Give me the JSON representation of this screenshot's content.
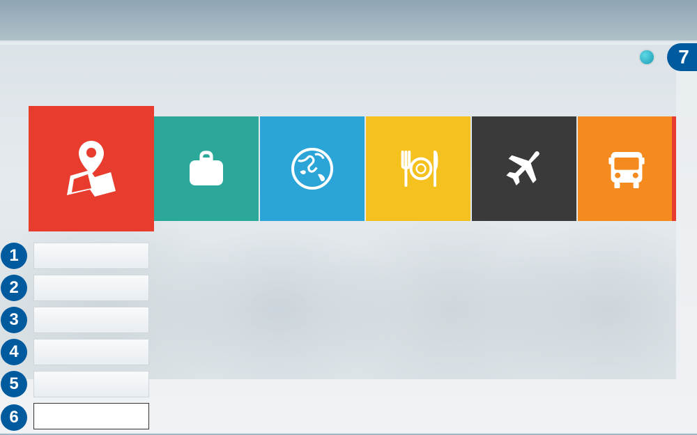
{
  "badges": {
    "top_right": "7",
    "numbers": [
      "1",
      "2",
      "3",
      "4",
      "5",
      "6"
    ]
  },
  "tiles": [
    {
      "id": "map",
      "name": "map-location-tile",
      "color": "#e73c2e",
      "icon": "map-pin",
      "selected": true
    },
    {
      "id": "bag",
      "name": "bag-tile",
      "color": "#2ca89a",
      "icon": "suitcase"
    },
    {
      "id": "globe",
      "name": "globe-tile",
      "color": "#2ba5d8",
      "icon": "globe"
    },
    {
      "id": "food",
      "name": "food-tile",
      "color": "#f5c11e",
      "icon": "restaurant"
    },
    {
      "id": "flight",
      "name": "flight-tile",
      "color": "#3a3a3a",
      "icon": "airplane"
    },
    {
      "id": "bus",
      "name": "bus-tile",
      "color": "#f58b1e",
      "icon": "bus"
    }
  ],
  "list_items": [
    {
      "label": ""
    },
    {
      "label": ""
    },
    {
      "label": ""
    },
    {
      "label": ""
    },
    {
      "label": ""
    },
    {
      "label": ""
    }
  ]
}
